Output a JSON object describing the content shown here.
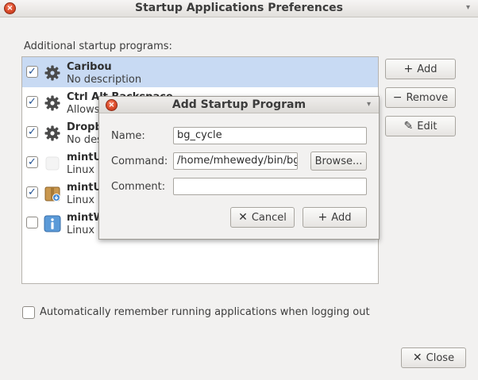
{
  "window": {
    "title": "Startup Applications Preferences",
    "close_glyph": "×",
    "menu_glyph": "▾"
  },
  "section_label": "Additional startup programs:",
  "apps": [
    {
      "name": "Caribou",
      "description": "No description",
      "checked": true,
      "icon": "gear-icon",
      "selected": true
    },
    {
      "name": "Ctrl Alt Backspace",
      "description": "Allows",
      "checked": true,
      "icon": "gear-icon",
      "selected": false
    },
    {
      "name": "Dropb",
      "description": "No desc",
      "checked": true,
      "icon": "gear-icon",
      "selected": false
    },
    {
      "name": "mintUp",
      "description": "Linux M",
      "checked": true,
      "icon": "blank-icon",
      "selected": false
    },
    {
      "name": "mintUp",
      "description": "Linux M",
      "checked": true,
      "icon": "package-icon",
      "selected": false
    },
    {
      "name": "mintW",
      "description": "Linux M",
      "checked": false,
      "icon": "info-icon",
      "selected": false
    }
  ],
  "buttons": {
    "add": "Add",
    "remove": "Remove",
    "edit": "Edit",
    "close": "Close"
  },
  "auto_remember_label": "Automatically remember running applications when logging out",
  "dialog": {
    "title": "Add Startup Program",
    "name_label": "Name:",
    "name_value": "bg_cycle",
    "command_label": "Command:",
    "command_value": "/home/mhewedy/bin/bg_",
    "browse": "Browse...",
    "comment_label": "Comment:",
    "comment_value": "",
    "cancel": "Cancel",
    "add": "Add"
  },
  "icons": {
    "add": "+",
    "remove": "−",
    "edit": "✎",
    "close": "✕",
    "check": "✓"
  },
  "colors": {
    "selection": "#c8daf3",
    "close_button": "#e0502e"
  }
}
